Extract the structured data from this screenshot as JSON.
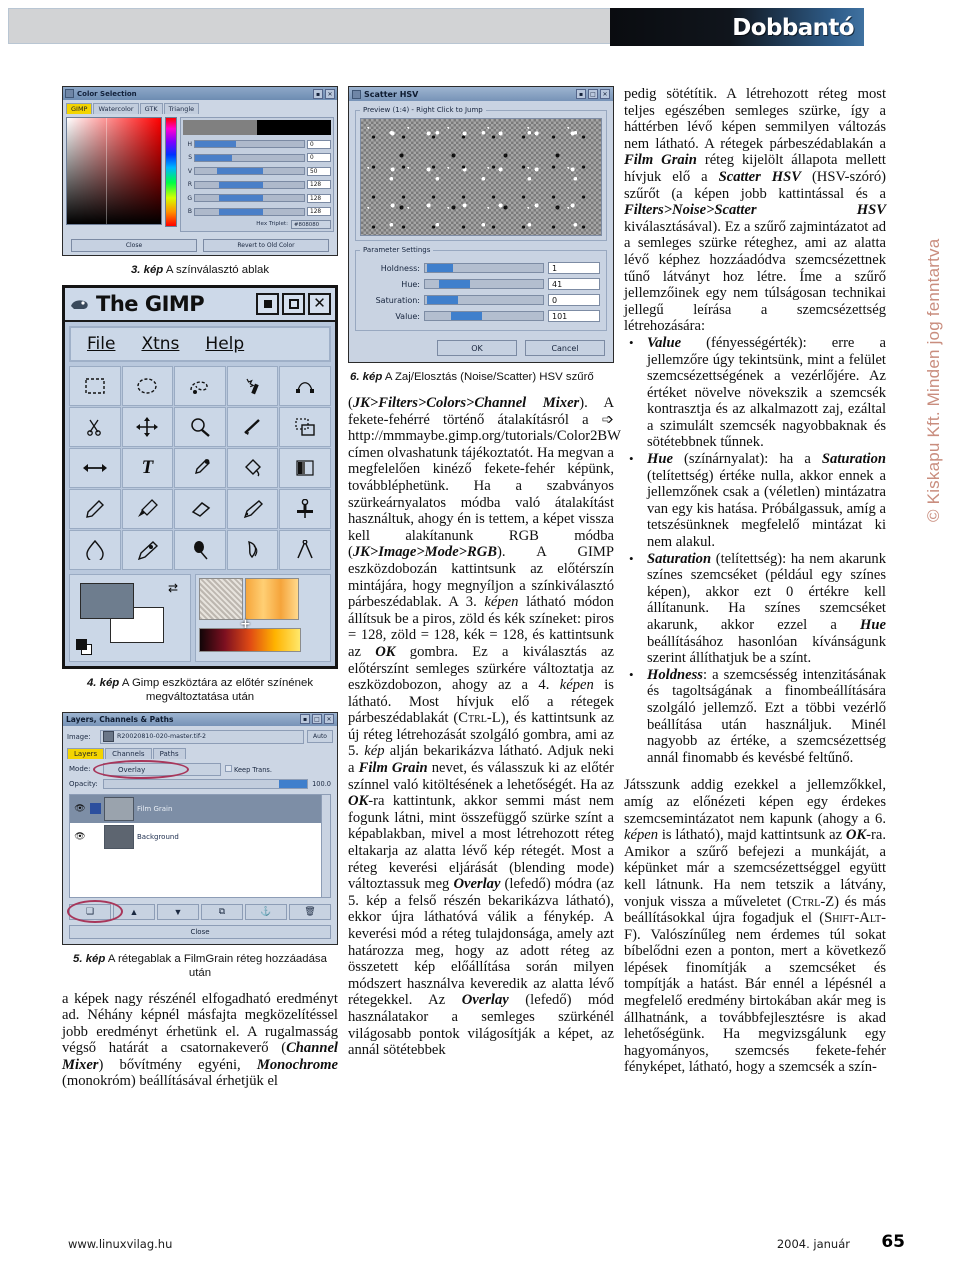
{
  "header": {
    "section_title": "Dobbantó"
  },
  "copyright_vertical": "© Kiskapu Kft. Minden jog fenntartva",
  "footer": {
    "url": "www.linuxvilag.hu",
    "date": "2004. január",
    "page": "65"
  },
  "figures": {
    "fig3": {
      "number": "3. kép",
      "caption": "A színválasztó ablak",
      "window": {
        "title": "Color Selection",
        "tabs": [
          "GIMP",
          "Watercolor",
          "GTK",
          "Triangle"
        ],
        "active_tab": "GIMP",
        "channels": [
          {
            "label": "H",
            "value": "0"
          },
          {
            "label": "S",
            "value": "0"
          },
          {
            "label": "V",
            "value": "50"
          },
          {
            "label": "R",
            "value": "128"
          },
          {
            "label": "G",
            "value": "128"
          },
          {
            "label": "B",
            "value": "128"
          }
        ],
        "hex_label": "Hex Triplet:",
        "hex_value": "#808080",
        "buttons": [
          "Close",
          "Revert to Old Color"
        ]
      }
    },
    "fig4": {
      "number": "4. kép",
      "caption": "A Gimp eszköztára az előtér színének megváltoztatása után",
      "window": {
        "title": "The GIMP",
        "menu": [
          "File",
          "Xtns",
          "Help"
        ],
        "tools": [
          "rect-select-icon",
          "ellipse-select-icon",
          "free-select-icon",
          "fuzzy-select-icon",
          "bezier-select-icon",
          "intelligent-scissors-icon",
          "move-icon",
          "magnify-icon",
          "crop-icon",
          "transform-icon",
          "flip-icon",
          "text-icon",
          "color-picker-icon",
          "bucket-fill-icon",
          "blend-gradient-icon",
          "pencil-icon",
          "paintbrush-icon",
          "eraser-icon",
          "airbrush-icon",
          "clone-icon",
          "blur-sharpen-icon",
          "ink-icon",
          "dodge-burn-icon",
          "smudge-icon",
          "measure-icon"
        ],
        "foreground_color": "#6e7d8e",
        "background_color": "#ffffff"
      }
    },
    "fig5": {
      "number": "5. kép",
      "caption": "A rétegablak a FilmGrain réteg hozzáadása után",
      "window": {
        "title": "Layers, Channels & Paths",
        "image_label": "Image:",
        "image_value": "R20020810-020-master.tif-2",
        "auto_label": "Auto",
        "tabs": [
          "Layers",
          "Channels",
          "Paths"
        ],
        "active_tab": "Layers",
        "mode_label": "Mode:",
        "mode_value": "Overlay",
        "keep_trans_label": "Keep Trans.",
        "opacity_label": "Opacity:",
        "opacity_value": "100.0",
        "layers": [
          {
            "name": "Film Grain",
            "selected": true
          },
          {
            "name": "Background",
            "selected": false
          }
        ],
        "close_label": "Close"
      }
    },
    "fig6": {
      "number": "6. kép",
      "caption": "A Zaj/Elosztás (Noise/Scatter) HSV szűrő",
      "window": {
        "title": "Scatter HSV",
        "preview_label": "Preview (1:4) - Right Click to Jump",
        "settings_label": "Parameter Settings",
        "params": [
          {
            "label": "Holdness:",
            "value": "1",
            "fill": 22
          },
          {
            "label": "Hue:",
            "value": "41",
            "fill": 34
          },
          {
            "label": "Saturation:",
            "value": "0",
            "fill": 26
          },
          {
            "label": "Value:",
            "value": "101",
            "fill": 40
          }
        ],
        "buttons": [
          "OK",
          "Cancel"
        ]
      }
    }
  },
  "columns": {
    "left": {
      "body": "a képek nagy részénél elfogadható eredményt ad. Néhány képnél másfajta megközelítéssel jobb eredményt érhetünk el. A rugalmasság végső határát a csatornakeverő (Channel Mixer) bővítmény egyéni, Monochrome (monokróm) beállításával érhetjük el"
    },
    "middle": {
      "p1_a": "(JK>Filters>Colors>Channel Mixer)",
      "p1_b": ". A fekete-fehérré történő átalakításról a ",
      "p1_url": "http://mmmaybe.gimp.org/tutorials/Color2BW",
      "p1_c": " címen olvashatunk tájékoztatót. Ha megvan a megfelelően kinéző fekete-fehér képünk, továbbléphetünk. Ha a szabványos szürkeárnyalatos módba való átalakítást használtuk, ahogy én is tettem, a képet vissza kell alakítanunk RGB módba ",
      "p1_d": "(JK>Image>Mode>RGB)",
      "p1_e": ". A GIMP eszközdobozán kattintsunk az előtérszín mintájára, hogy megnyíljon a színkiválasztó párbeszédablak. A 3. ",
      "p1_f": "képen",
      "p1_g": " látható módon állítsuk be a piros, zöld és kék színeket: piros = 128, zöld = 128, kék = 128, és kattintsunk az ",
      "p1_h": "OK",
      "p1_i": " gombra. Ez a kiválasztás az előtérszínt semleges szürkére változtatja az eszközdobozon, ahogy az a 4. ",
      "p1_j": "képen",
      "p1_k": " is látható. Most hívjuk elő a rétegek párbeszédablakát (",
      "p1_ctrl": "Ctrl",
      "p1_l": "-L), és kattintsunk az új réteg létrehozását szolgáló gombra, ami az 5. ",
      "p1_m": "kép",
      "p1_n": " alján bekarikázva látható. Adjuk neki a ",
      "p1_o": "Film Grain",
      "p1_p": " nevet, és válasszuk ki az előtér színnel való kitöltésének a lehetőségét. Ha az ",
      "p1_q": "OK",
      "p1_r": "-ra kattintunk, akkor semmi mást nem fogunk látni, mint összefüggő szürke színt a képablakban, mivel a most létrehozott réteg eltakarja az alatta lévő kép rétegét. Most a réteg keverési eljárását (blending mode) változtassuk meg ",
      "p1_s": "Overlay",
      "p1_t": " (lefedő) módra (az 5. kép a felső részén bekarikázva látható), ekkor újra láthatóvá válik a fénykép. A keverési mód a réteg tulajdonsága, amely azt határozza meg, hogy az adott réteg az összetett kép előállítása során milyen módszert használva keveredik az alatta lévő rétegekkel. Az ",
      "p1_u": "Overlay",
      "p1_v": " (lefedő) mód használatakor a semleges szürkénél világosabb pontok világosítják a képet, az annál sötétebbek"
    },
    "right": {
      "p1_a": "pedig sötétítik. A létrehozott réteg most teljes egészében semleges szürke, így a háttérben lévő képen semmilyen változás nem látható. A rétegek párbeszédablakán a ",
      "p1_b": "Film Grain",
      "p1_c": " réteg kijelölt állapota mellett hívjuk elő a ",
      "p1_d": "Scatter HSV",
      "p1_e": " (HSV-szóró) szűrőt (a képen jobb kattintással és a ",
      "p1_f": "Filters>Noise>Scatter HSV",
      "p1_g": " kiválasztásával). Ez a szűrő zajmintázatot ad a semleges szürke réteghez, ami az alatta lévő képhez hozzáadódva szemcsézettnek tűnő látványt hoz létre. Íme a szűrő jellemzőinek egy nem túlságosan technikai jellegű leírása a szemcsézettség létrehozására:",
      "bullets": [
        {
          "term": "Value",
          "text": " (fényességérték): erre a jellemzőre úgy tekintsünk, mint a felület szemcsézettségének a vezérlőjére. Az  értéket növelve növekszik a szemcsék kontrasztja és az alkalmazott zaj, ezáltal a szimulált szemcsék nagyobbaknak és sötétebbnek tűnnek."
        },
        {
          "term": "Hue",
          "text": " (színárnyalat): ha a Saturation (telítettség) értéke nulla, akkor ennek a jellemzőnek csak a (véletlen) mintázatra van egy kis hatása. Próbálgassuk, amíg a tetszésünknek megfelelő mintázat ki nem alakul."
        },
        {
          "term": "Saturation",
          "text": " (telítettség): ha nem akarunk színes szemcséket (például egy színes képen), akkor ezt 0 értékre kell állítanunk. Ha színes szemcséket akarunk, akkor ezzel a Hue beállításához hasonlóan kívánságunk szerint állíthatjuk be a színt."
        },
        {
          "term": "Holdness",
          "text": ": a szemcsésség intenzitásának és tagoltságának a finombeállítására szolgáló jellemző. Ezt a többi vezérlő beállítása után használjuk. Minél nagyobb az értéke, a szemcsézettség annál finomabb és kevésbé feltűnő."
        }
      ],
      "p2_a": "Játsszunk addig ezekkel a jellemzőkkel, amíg az előnézeti képen egy érdekes szemcsemintázatot nem kapunk (ahogy a  6. ",
      "p2_b": "képen",
      "p2_c": " is látható), majd kattintsunk az ",
      "p2_d": "OK",
      "p2_e": "-ra. Amikor a szűrő befejezi a munkáját, a képünket már a szemcsézettséggel együtt kell látnunk. Ha nem tetszik a látvány, vonjuk vissza a műveletet (",
      "p2_ctrl": "Ctrl",
      "p2_f": "-Z) és más beállításokkal újra fogadjuk el (",
      "p2_shift": "Shift-Alt",
      "p2_g": "-F). Valószínűleg nem érdemes túl sokat bíbelődni ezen a ponton, mert a következő lépések finomítják a szemcséket és tompítják a hatást. Bár ennél a lépésnél a megfelelő eredmény birtokában akár meg is állhatnánk, a továbbfejlesztésre is akad lehetőségünk. Ha megvizsgálunk egy hagyományos, szemcsés fekete-fehér fényképet, látható, hogy a szemcsék a szín-"
    }
  }
}
